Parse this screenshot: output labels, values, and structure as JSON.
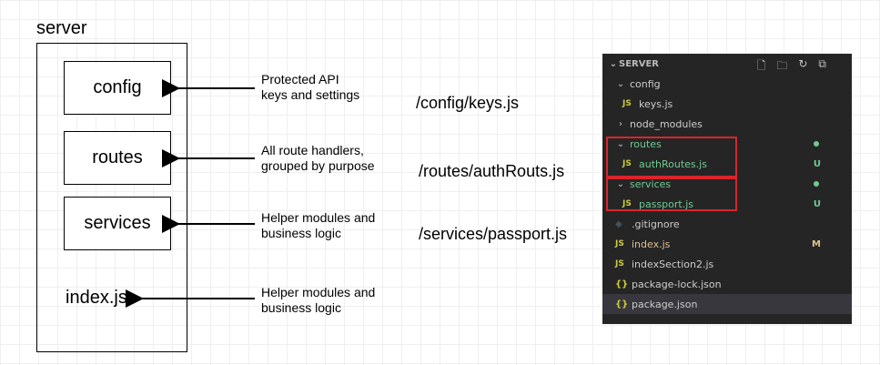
{
  "diagram": {
    "server_title": "server",
    "modules": [
      {
        "label": "config",
        "desc_line1": "Protected API",
        "desc_line2": "keys and settings",
        "path": "/config/keys.js"
      },
      {
        "label": "routes",
        "desc_line1": "All route handlers,",
        "desc_line2": "grouped by purpose",
        "path": "/routes/authRouts.js"
      },
      {
        "label": "services",
        "desc_line1": "Helper modules and",
        "desc_line2": "business logic",
        "path": "/services/passport.js"
      }
    ],
    "index": {
      "label": "index.js",
      "desc_line1": "Helper modules and",
      "desc_line2": "business logic"
    }
  },
  "explorer": {
    "header": "SERVER",
    "action_icons": [
      "new-file-icon",
      "new-folder-icon",
      "refresh-icon",
      "collapse-all-icon"
    ],
    "highlight_color": "#d9252b",
    "rows": [
      {
        "name": "config",
        "kind": "folder",
        "expanded": true,
        "indent": 1
      },
      {
        "name": "keys.js",
        "kind": "js",
        "indent": 2
      },
      {
        "name": "node_modules",
        "kind": "folder",
        "expanded": false,
        "indent": 1
      },
      {
        "name": "routes",
        "kind": "folder",
        "expanded": true,
        "indent": 1,
        "color": "#73c991"
      },
      {
        "name": "authRoutes.js",
        "kind": "js",
        "indent": 2,
        "color": "#73c991",
        "badge": "U"
      },
      {
        "name": "services",
        "kind": "folder",
        "expanded": true,
        "indent": 1,
        "color": "#73c991"
      },
      {
        "name": "passport.js",
        "kind": "js",
        "indent": 2,
        "color": "#73c991",
        "badge": "U"
      },
      {
        "name": ".gitignore",
        "kind": "git",
        "indent": 1
      },
      {
        "name": "index.js",
        "kind": "js",
        "indent": 1,
        "color": "#e2c08d",
        "badge": "M"
      },
      {
        "name": "indexSection2.js",
        "kind": "js",
        "indent": 1
      },
      {
        "name": "package-lock.json",
        "kind": "json",
        "indent": 1
      },
      {
        "name": "package.json",
        "kind": "json",
        "indent": 1,
        "selected": true
      }
    ]
  }
}
